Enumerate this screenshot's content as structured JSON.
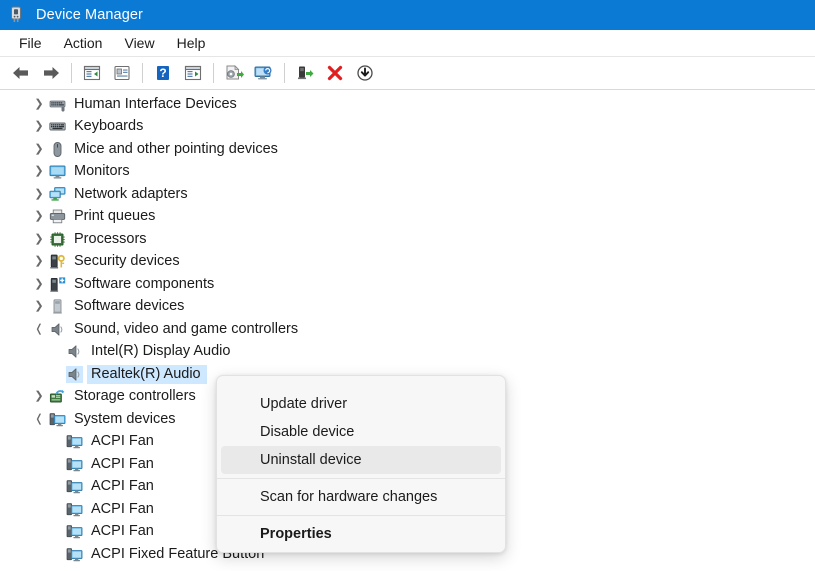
{
  "window": {
    "title": "Device Manager",
    "icon": "device-manager-icon",
    "titlebar_color": "#0B7AD4"
  },
  "menubar": {
    "items": [
      {
        "label": "File",
        "name": "menu-file"
      },
      {
        "label": "Action",
        "name": "menu-action"
      },
      {
        "label": "View",
        "name": "menu-view"
      },
      {
        "label": "Help",
        "name": "menu-help"
      }
    ]
  },
  "toolbar": {
    "buttons": [
      {
        "name": "back-button",
        "icon": "back-arrow-icon",
        "title": "Back"
      },
      {
        "name": "forward-button",
        "icon": "forward-arrow-icon",
        "title": "Forward"
      },
      {
        "name": "show-hide-console-tree-button",
        "icon": "console-tree-icon",
        "title": "Show/Hide Console Tree"
      },
      {
        "name": "properties-button",
        "icon": "properties-panel-icon",
        "title": "Properties"
      },
      {
        "name": "help-button",
        "icon": "help-icon",
        "title": "Help"
      },
      {
        "name": "show-hide-action-pane-button",
        "icon": "action-pane-icon",
        "title": "Show/Hide Action Pane"
      },
      {
        "name": "update-driver-button",
        "icon": "update-driver-icon",
        "title": "Update Driver Software"
      },
      {
        "name": "scan-hardware-changes-button",
        "icon": "scan-hardware-icon",
        "title": "Scan for hardware changes"
      },
      {
        "name": "enable-device-button",
        "icon": "enable-device-icon",
        "title": "Enable device"
      },
      {
        "name": "uninstall-device-button",
        "icon": "red-x-icon",
        "title": "Uninstall device"
      },
      {
        "name": "disable-device-button",
        "icon": "down-arrow-circle-icon",
        "title": "Disable device"
      }
    ]
  },
  "tree": {
    "items": [
      {
        "label": "Human Interface Devices",
        "icon": "hid-icon",
        "state": "collapsed",
        "level": 0,
        "selected": false
      },
      {
        "label": "Keyboards",
        "icon": "keyboard-icon",
        "state": "collapsed",
        "level": 0,
        "selected": false
      },
      {
        "label": "Mice and other pointing devices",
        "icon": "mouse-icon",
        "state": "collapsed",
        "level": 0,
        "selected": false
      },
      {
        "label": "Monitors",
        "icon": "monitor-icon",
        "state": "collapsed",
        "level": 0,
        "selected": false
      },
      {
        "label": "Network adapters",
        "icon": "network-adapter-icon",
        "state": "collapsed",
        "level": 0,
        "selected": false
      },
      {
        "label": "Print queues",
        "icon": "printer-icon",
        "state": "collapsed",
        "level": 0,
        "selected": false
      },
      {
        "label": "Processors",
        "icon": "processor-icon",
        "state": "collapsed",
        "level": 0,
        "selected": false
      },
      {
        "label": "Security devices",
        "icon": "security-device-icon",
        "state": "collapsed",
        "level": 0,
        "selected": false
      },
      {
        "label": "Software components",
        "icon": "software-component-icon",
        "state": "collapsed",
        "level": 0,
        "selected": false
      },
      {
        "label": "Software devices",
        "icon": "software-device-icon",
        "state": "collapsed",
        "level": 0,
        "selected": false
      },
      {
        "label": "Sound, video and game controllers",
        "icon": "speaker-icon",
        "state": "expanded",
        "level": 0,
        "selected": false
      },
      {
        "label": "Intel(R) Display Audio",
        "icon": "speaker-icon",
        "state": "leaf",
        "level": 1,
        "selected": false
      },
      {
        "label": "Realtek(R) Audio",
        "icon": "speaker-icon",
        "state": "leaf",
        "level": 1,
        "selected": true
      },
      {
        "label": "Storage controllers",
        "icon": "storage-controller-icon",
        "state": "collapsed",
        "level": 0,
        "selected": false
      },
      {
        "label": "System devices",
        "icon": "system-device-icon",
        "state": "expanded",
        "level": 0,
        "selected": false
      },
      {
        "label": "ACPI Fan",
        "icon": "system-device-icon",
        "state": "leaf",
        "level": 1,
        "selected": false
      },
      {
        "label": "ACPI Fan",
        "icon": "system-device-icon",
        "state": "leaf",
        "level": 1,
        "selected": false
      },
      {
        "label": "ACPI Fan",
        "icon": "system-device-icon",
        "state": "leaf",
        "level": 1,
        "selected": false
      },
      {
        "label": "ACPI Fan",
        "icon": "system-device-icon",
        "state": "leaf",
        "level": 1,
        "selected": false
      },
      {
        "label": "ACPI Fan",
        "icon": "system-device-icon",
        "state": "leaf",
        "level": 1,
        "selected": false
      },
      {
        "label": "ACPI Fixed Feature Button",
        "icon": "system-device-icon",
        "state": "leaf",
        "level": 1,
        "selected": false
      }
    ],
    "selection_color": "#cde8ff"
  },
  "context_menu": {
    "items": [
      {
        "label": "Update driver",
        "name": "ctx-update-driver",
        "highlighted": false,
        "bold": false
      },
      {
        "label": "Disable device",
        "name": "ctx-disable-device",
        "highlighted": false,
        "bold": false
      },
      {
        "label": "Uninstall device",
        "name": "ctx-uninstall-device",
        "highlighted": true,
        "bold": false
      },
      {
        "label": "Scan for hardware changes",
        "name": "ctx-scan-hardware-changes",
        "highlighted": false,
        "bold": false
      },
      {
        "label": "Properties",
        "name": "ctx-properties",
        "highlighted": false,
        "bold": true
      }
    ],
    "highlight_color": "#e9e9e9"
  }
}
